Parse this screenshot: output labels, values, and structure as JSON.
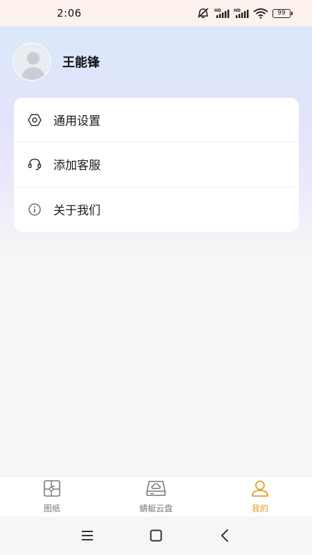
{
  "status_bar": {
    "time": "2:06",
    "battery": "99",
    "icons": [
      "mute-icon",
      "hd-signal-icon",
      "hd-signal-icon",
      "wifi-icon",
      "battery-icon"
    ]
  },
  "profile": {
    "name": "王能锋",
    "avatar_icon": "default-avatar-icon"
  },
  "menu": {
    "items": [
      {
        "label": "通用设置",
        "icon": "settings-hexagon-icon"
      },
      {
        "label": "添加客服",
        "icon": "headset-icon"
      },
      {
        "label": "关于我们",
        "icon": "info-icon"
      }
    ]
  },
  "tab_bar": {
    "tabs": [
      {
        "label": "图纸",
        "icon": "blueprint-icon",
        "active": false
      },
      {
        "label": "蜻蜓云盘",
        "icon": "cloud-drive-icon",
        "active": false
      },
      {
        "label": "我的",
        "icon": "person-icon",
        "active": true
      }
    ]
  },
  "colors": {
    "accent": "#e39a2c",
    "status_bar_bg": "#fdf1ee",
    "gradient_top": "#d8e8fb",
    "page_bg": "#f6f6f6"
  },
  "nav_bar": {
    "buttons": [
      "menu-icon",
      "home-icon",
      "back-icon"
    ]
  }
}
